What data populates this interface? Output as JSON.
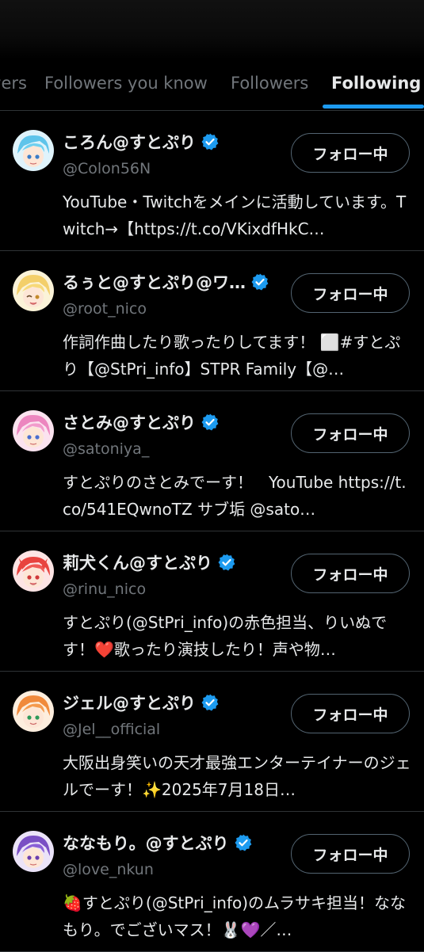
{
  "tabs": [
    {
      "label": "Verified Followers"
    },
    {
      "label": "Followers you know"
    },
    {
      "label": "Followers"
    },
    {
      "label": "Following",
      "active": true
    }
  ],
  "colors": {
    "accent": "#1d9bf0",
    "secondary_text": "#71767b",
    "divider": "#2f3336"
  },
  "users": [
    {
      "name": "ころん@すとぷり",
      "handle": "@Colon56N",
      "bio": "YouTube・Twitchをメインに活動しています。Twitch→【https://t.co/VKixdfHkC…",
      "follow_label": "フォロー中",
      "verified": true
    },
    {
      "name": "るぅと@すとぷり@ワ…",
      "handle": "@root_nico",
      "bio": "作詞作曲したり歌ったりしてます！ ⬜#すとぷり【@StPri_info】STPR Family【@…",
      "follow_label": "フォロー中",
      "verified": true
    },
    {
      "name": "さとみ@すとぷり",
      "handle": "@satoniya_",
      "bio": "すとぷりのさとみでーす！　YouTube https://t.co/541EQwnoTZ サブ垢 @sato…",
      "follow_label": "フォロー中",
      "verified": true
    },
    {
      "name": "莉犬くん@すとぷり",
      "handle": "@rinu_nico",
      "bio": "すとぷり(@StPri_info)の赤色担当、りいぬです！❤️歌ったり演技したり！声や物…",
      "follow_label": "フォロー中",
      "verified": true
    },
    {
      "name": "ジェル@すとぷり",
      "handle": "@Jel__official",
      "bio": "大阪出身笑いの天才最強エンターテイナーのジェルでーす！✨2025年7月18日…",
      "follow_label": "フォロー中",
      "verified": true
    },
    {
      "name": "ななもり。@すとぷり",
      "handle": "@love_nkun",
      "bio": "🍓すとぷり(@StPri_info)のムラサキ担当！ななもり。でございマス！🐰💜／…",
      "follow_label": "フォロー中",
      "verified": true
    }
  ]
}
